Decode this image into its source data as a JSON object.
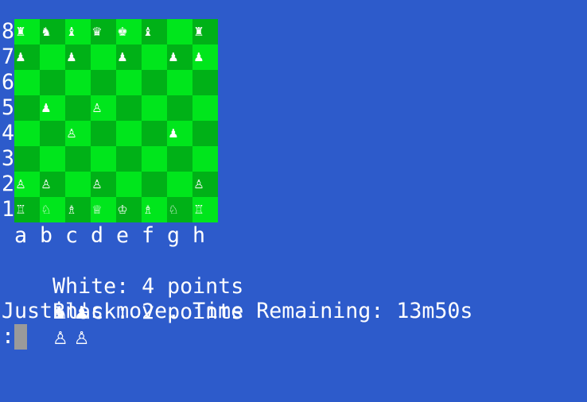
{
  "colors": {
    "background": "#2d5bcb",
    "square_light": "#00e61c",
    "square_dark": "#00b117",
    "cursor": "#9a9a9a",
    "text": "#ffffff"
  },
  "board": {
    "ranks": [
      "8",
      "7",
      "6",
      "5",
      "4",
      "3",
      "2",
      "1"
    ],
    "files": [
      "a",
      "b",
      "c",
      "d",
      "e",
      "f",
      "g",
      "h"
    ],
    "rows": [
      [
        "♜",
        "♞",
        "♝",
        "♛",
        "♚",
        "♝",
        "",
        "♜"
      ],
      [
        "♟",
        "",
        "♟",
        "",
        "♟",
        "",
        "♟",
        "♟"
      ],
      [
        "",
        "",
        "",
        "",
        "",
        "",
        "",
        ""
      ],
      [
        "",
        "♟",
        "",
        "♙",
        "",
        "",
        "",
        ""
      ],
      [
        "",
        "",
        "♙",
        "",
        "",
        "",
        "♟",
        ""
      ],
      [
        "",
        "",
        "",
        "",
        "",
        "",
        "",
        ""
      ],
      [
        "♙",
        "♙",
        "",
        "♙",
        "",
        "",
        "",
        "♙"
      ],
      [
        "♖",
        "♘",
        "♗",
        "♕",
        "♔",
        "♗",
        "♘",
        "♖"
      ]
    ]
  },
  "status": {
    "white_score": "White: 4 points",
    "white_captured": "♞ ♟",
    "black_score": "Black: 2 points",
    "black_captured": "♙ ♙",
    "move_line": "Justin's move. Time Remaining: 13m50s",
    "prompt": ":"
  }
}
